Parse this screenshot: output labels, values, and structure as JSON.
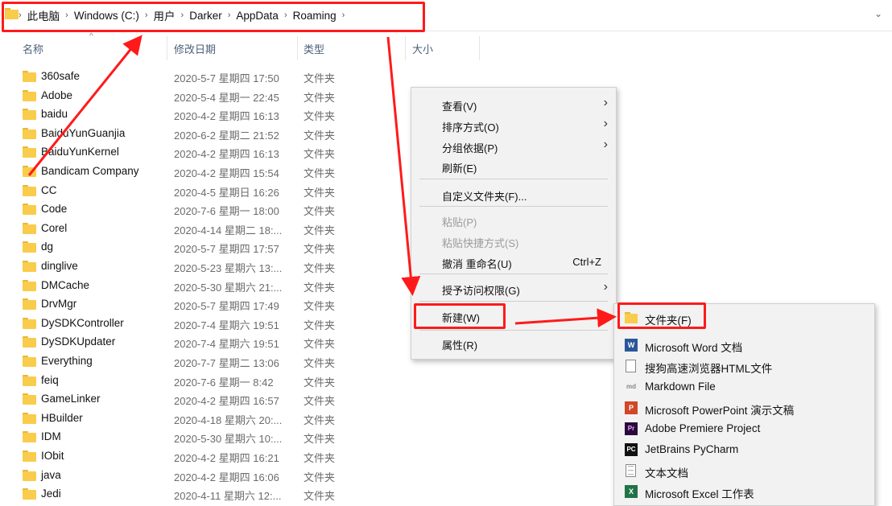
{
  "breadcrumb": [
    "此电脑",
    "Windows (C:)",
    "用户",
    "Darker",
    "AppData",
    "Roaming"
  ],
  "columns": {
    "name": "名称",
    "modified": "修改日期",
    "type": "类型",
    "size": "大小"
  },
  "files": [
    {
      "name": "360safe",
      "date": "2020-5-7 星期四 17:50",
      "type": "文件夹"
    },
    {
      "name": "Adobe",
      "date": "2020-5-4 星期一 22:45",
      "type": "文件夹"
    },
    {
      "name": "baidu",
      "date": "2020-4-2 星期四 16:13",
      "type": "文件夹"
    },
    {
      "name": "BaiduYunGuanjia",
      "date": "2020-6-2 星期二 21:52",
      "type": "文件夹"
    },
    {
      "name": "BaiduYunKernel",
      "date": "2020-4-2 星期四 16:13",
      "type": "文件夹"
    },
    {
      "name": "Bandicam Company",
      "date": "2020-4-2 星期四 15:54",
      "type": "文件夹"
    },
    {
      "name": "CC",
      "date": "2020-4-5 星期日 16:26",
      "type": "文件夹"
    },
    {
      "name": "Code",
      "date": "2020-7-6 星期一 18:00",
      "type": "文件夹"
    },
    {
      "name": "Corel",
      "date": "2020-4-14 星期二 18:...",
      "type": "文件夹"
    },
    {
      "name": "dg",
      "date": "2020-5-7 星期四 17:57",
      "type": "文件夹"
    },
    {
      "name": "dinglive",
      "date": "2020-5-23 星期六 13:...",
      "type": "文件夹"
    },
    {
      "name": "DMCache",
      "date": "2020-5-30 星期六 21:...",
      "type": "文件夹"
    },
    {
      "name": "DrvMgr",
      "date": "2020-5-7 星期四 17:49",
      "type": "文件夹"
    },
    {
      "name": "DySDKController",
      "date": "2020-7-4 星期六 19:51",
      "type": "文件夹"
    },
    {
      "name": "DySDKUpdater",
      "date": "2020-7-4 星期六 19:51",
      "type": "文件夹"
    },
    {
      "name": "Everything",
      "date": "2020-7-7 星期二 13:06",
      "type": "文件夹"
    },
    {
      "name": "feiq",
      "date": "2020-7-6 星期一 8:42",
      "type": "文件夹"
    },
    {
      "name": "GameLinker",
      "date": "2020-4-2 星期四 16:57",
      "type": "文件夹"
    },
    {
      "name": "HBuilder",
      "date": "2020-4-18 星期六 20:...",
      "type": "文件夹"
    },
    {
      "name": "IDM",
      "date": "2020-5-30 星期六 10:...",
      "type": "文件夹"
    },
    {
      "name": "IObit",
      "date": "2020-4-2 星期四 16:21",
      "type": "文件夹"
    },
    {
      "name": "java",
      "date": "2020-4-2 星期四 16:06",
      "type": "文件夹"
    },
    {
      "name": "Jedi",
      "date": "2020-4-11 星期六 12:...",
      "type": "文件夹"
    }
  ],
  "context_menu": [
    {
      "label": "查看(V)",
      "submenu": true
    },
    {
      "label": "排序方式(O)",
      "submenu": true
    },
    {
      "label": "分组依据(P)",
      "submenu": true
    },
    {
      "label": "刷新(E)"
    },
    {
      "label": "自定义文件夹(F)..."
    },
    {
      "label": "粘贴(P)",
      "disabled": true
    },
    {
      "label": "粘贴快捷方式(S)",
      "disabled": true
    },
    {
      "label": "撤消 重命名(U)",
      "shortcut": "Ctrl+Z"
    },
    {
      "label": "授予访问权限(G)",
      "submenu": true
    },
    {
      "label": "新建(W)",
      "submenu": true
    },
    {
      "label": "属性(R)"
    }
  ],
  "new_submenu": [
    {
      "label": "文件夹(F)",
      "icon": "folder-icon"
    },
    {
      "label": "Microsoft Word 文档",
      "icon": "word-icon"
    },
    {
      "label": "搜狗高速浏览器HTML文件",
      "icon": "html-file-icon"
    },
    {
      "label": "Markdown File",
      "icon": "markdown-icon"
    },
    {
      "label": "Microsoft PowerPoint 演示文稿",
      "icon": "powerpoint-icon"
    },
    {
      "label": "Adobe Premiere Project",
      "icon": "premiere-icon"
    },
    {
      "label": "JetBrains PyCharm",
      "icon": "pycharm-icon"
    },
    {
      "label": "文本文档",
      "icon": "text-document-icon"
    },
    {
      "label": "Microsoft Excel 工作表",
      "icon": "excel-icon"
    }
  ],
  "colors": {
    "annotation": "#ff1a1a",
    "folder": "#f9cc4b",
    "header_text": "#4c607a"
  }
}
